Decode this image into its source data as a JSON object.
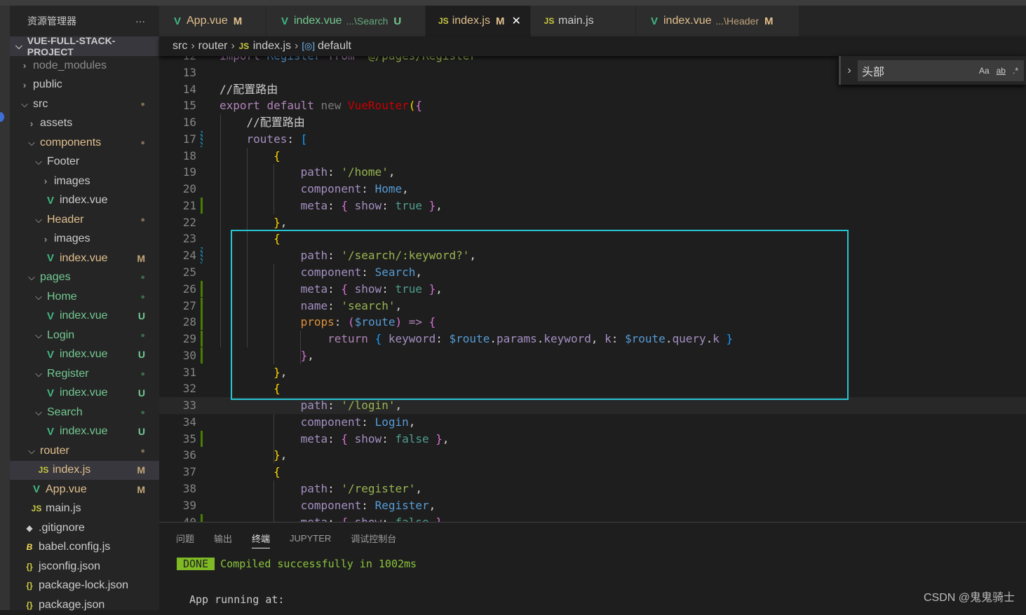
{
  "sidebar": {
    "title": "资源管理器",
    "more": "···",
    "project": "VUE-FULL-STACK-PROJECT",
    "items": [
      {
        "label": "node_modules",
        "level": 1,
        "icon": "chevron-right",
        "color": "#8c8c8c"
      },
      {
        "label": "public",
        "level": 1,
        "icon": "chevron-right",
        "color": "#cccccc"
      },
      {
        "label": "src",
        "level": 1,
        "icon": "chevron-down",
        "color": "#cccccc",
        "badge": "●",
        "badge_color": "#7d6e55"
      },
      {
        "label": "assets",
        "level": 2,
        "icon": "chevron-right",
        "color": "#cccccc"
      },
      {
        "label": "components",
        "level": 2,
        "icon": "chevron-down",
        "color": "#e2c08d",
        "badge": "●",
        "badge_color": "#7d6e55"
      },
      {
        "label": "Footer",
        "level": 3,
        "icon": "chevron-down",
        "color": "#cccccc"
      },
      {
        "label": "images",
        "level": 4,
        "icon": "chevron-right",
        "color": "#cccccc"
      },
      {
        "label": "index.vue",
        "level": 4,
        "icon": "vue",
        "color": "#cccccc"
      },
      {
        "label": "Header",
        "level": 3,
        "icon": "chevron-down",
        "color": "#e2c08d",
        "badge": "●",
        "badge_color": "#7d6e55"
      },
      {
        "label": "images",
        "level": 4,
        "icon": "chevron-right",
        "color": "#cccccc"
      },
      {
        "label": "index.vue",
        "level": 4,
        "icon": "vue",
        "color": "#e2c08d",
        "badge": "M",
        "badge_color": "#c2a679"
      },
      {
        "label": "pages",
        "level": 2,
        "icon": "chevron-down",
        "color": "#73c991",
        "badge": "●",
        "badge_color": "#3d6b4d"
      },
      {
        "label": "Home",
        "level": 3,
        "icon": "chevron-down",
        "color": "#73c991",
        "badge": "●",
        "badge_color": "#3d6b4d"
      },
      {
        "label": "index.vue",
        "level": 4,
        "icon": "vue",
        "color": "#73c991",
        "badge": "U",
        "badge_color": "#73c991"
      },
      {
        "label": "Login",
        "level": 3,
        "icon": "chevron-down",
        "color": "#73c991",
        "badge": "●",
        "badge_color": "#3d6b4d"
      },
      {
        "label": "index.vue",
        "level": 4,
        "icon": "vue",
        "color": "#73c991",
        "badge": "U",
        "badge_color": "#73c991"
      },
      {
        "label": "Register",
        "level": 3,
        "icon": "chevron-down",
        "color": "#73c991",
        "badge": "●",
        "badge_color": "#3d6b4d"
      },
      {
        "label": "index.vue",
        "level": 4,
        "icon": "vue",
        "color": "#73c991",
        "badge": "U",
        "badge_color": "#73c991"
      },
      {
        "label": "Search",
        "level": 3,
        "icon": "chevron-down",
        "color": "#73c991",
        "badge": "●",
        "badge_color": "#3d6b4d"
      },
      {
        "label": "index.vue",
        "level": 4,
        "icon": "vue",
        "color": "#73c991",
        "badge": "U",
        "badge_color": "#73c991"
      },
      {
        "label": "router",
        "level": 2,
        "icon": "chevron-down",
        "color": "#e2c08d",
        "badge": "●",
        "badge_color": "#7d6e55"
      },
      {
        "label": "index.js",
        "level": 3,
        "icon": "js",
        "color": "#e2c08d",
        "badge": "M",
        "badge_color": "#c2a679",
        "selected": true
      },
      {
        "label": "App.vue",
        "level": 2,
        "icon": "vue",
        "color": "#e2c08d",
        "badge": "M",
        "badge_color": "#c2a679"
      },
      {
        "label": "main.js",
        "level": 2,
        "icon": "js",
        "color": "#cccccc"
      },
      {
        "label": ".gitignore",
        "level": 1,
        "icon": "git",
        "color": "#cccccc"
      },
      {
        "label": "babel.config.js",
        "level": 1,
        "icon": "babel",
        "color": "#cccccc"
      },
      {
        "label": "jsconfig.json",
        "level": 1,
        "icon": "json",
        "color": "#cccccc"
      },
      {
        "label": "package-lock.json",
        "level": 1,
        "icon": "json",
        "color": "#cccccc"
      },
      {
        "label": "package.json",
        "level": 1,
        "icon": "json",
        "color": "#cccccc"
      }
    ]
  },
  "tabs": [
    {
      "label": "App.vue",
      "icon": "vue",
      "desc": "",
      "status": "M",
      "color": "#e2c08d"
    },
    {
      "label": "index.vue",
      "icon": "vue",
      "desc": "...\\Search",
      "status": "U",
      "color": "#73c991"
    },
    {
      "label": "index.js",
      "icon": "js",
      "desc": "",
      "status": "M",
      "color": "#e2c08d",
      "active": true,
      "close": "✕"
    },
    {
      "label": "main.js",
      "icon": "js",
      "desc": "",
      "status": "",
      "color": "#cccccc"
    },
    {
      "label": "index.vue",
      "icon": "vue",
      "desc": "...\\Header",
      "status": "M",
      "color": "#e2c08d"
    }
  ],
  "breadcrumb": [
    "src",
    "router",
    "index.js",
    "default"
  ],
  "find": {
    "value": "头部",
    "case": "Aa",
    "word": "ab",
    "regex": ".*"
  },
  "editor": {
    "first_line": 12,
    "current_line": 33,
    "lines": [
      [
        [
          "import ",
          "kw"
        ],
        [
          "Register ",
          "cls"
        ],
        [
          "from ",
          "kw"
        ],
        [
          "'@/pages/Register'",
          "str"
        ]
      ],
      [],
      [
        [
          "//配置路由",
          "cm"
        ]
      ],
      [
        [
          "export ",
          "kw"
        ],
        [
          "default ",
          "kw"
        ],
        [
          "new ",
          "new"
        ],
        [
          "VueRouter",
          "red"
        ],
        [
          "(",
          "b1"
        ],
        [
          "{",
          "b2"
        ]
      ],
      [
        [
          "    //配置路由",
          "cm"
        ]
      ],
      [
        [
          "    routes",
          "prop"
        ],
        [
          ": ",
          "p"
        ],
        [
          "[",
          "b3"
        ]
      ],
      [
        [
          "        {",
          "b1"
        ]
      ],
      [
        [
          "            path",
          "prop"
        ],
        [
          ": ",
          "p"
        ],
        [
          "'/home'",
          "str"
        ],
        [
          ",",
          "p"
        ]
      ],
      [
        [
          "            component",
          "prop"
        ],
        [
          ": ",
          "p"
        ],
        [
          "Home",
          "cls"
        ],
        [
          ",",
          "p"
        ]
      ],
      [
        [
          "            meta",
          "prop"
        ],
        [
          ": ",
          "p"
        ],
        [
          "{ ",
          "b2"
        ],
        [
          "show",
          "prop"
        ],
        [
          ": ",
          "p"
        ],
        [
          "true ",
          "bool"
        ],
        [
          "}",
          "b2"
        ],
        [
          ",",
          "p"
        ]
      ],
      [
        [
          "        }",
          "b1"
        ],
        [
          ",",
          "p"
        ]
      ],
      [
        [
          "        {",
          "b1"
        ]
      ],
      [
        [
          "            path",
          "prop"
        ],
        [
          ": ",
          "p"
        ],
        [
          "'/search/:keyword?'",
          "str"
        ],
        [
          ",",
          "p"
        ]
      ],
      [
        [
          "            component",
          "prop"
        ],
        [
          ": ",
          "p"
        ],
        [
          "Search",
          "cls"
        ],
        [
          ",",
          "p"
        ]
      ],
      [
        [
          "            meta",
          "prop"
        ],
        [
          ": ",
          "p"
        ],
        [
          "{ ",
          "b2"
        ],
        [
          "show",
          "prop"
        ],
        [
          ": ",
          "p"
        ],
        [
          "true ",
          "bool"
        ],
        [
          "}",
          "b2"
        ],
        [
          ",",
          "p"
        ]
      ],
      [
        [
          "            name",
          "prop"
        ],
        [
          ": ",
          "p"
        ],
        [
          "'search'",
          "str"
        ],
        [
          ",",
          "p"
        ]
      ],
      [
        [
          "            props",
          "fn"
        ],
        [
          ": ",
          "p"
        ],
        [
          "(",
          "b2"
        ],
        [
          "$route",
          "cls"
        ],
        [
          ") ",
          "b2"
        ],
        [
          "=> ",
          "kw"
        ],
        [
          "{",
          "b2"
        ]
      ],
      [
        [
          "                return ",
          "kw"
        ],
        [
          "{ ",
          "b3"
        ],
        [
          "keyword",
          "prop"
        ],
        [
          ": ",
          "p"
        ],
        [
          "$route",
          "cls"
        ],
        [
          ".",
          "p"
        ],
        [
          "params",
          "prop"
        ],
        [
          ".",
          "p"
        ],
        [
          "keyword",
          "prop"
        ],
        [
          ", ",
          "p"
        ],
        [
          "k",
          "prop"
        ],
        [
          ": ",
          "p"
        ],
        [
          "$route",
          "cls"
        ],
        [
          ".",
          "p"
        ],
        [
          "query",
          "prop"
        ],
        [
          ".",
          "p"
        ],
        [
          "k ",
          "prop"
        ],
        [
          "}",
          "b3"
        ]
      ],
      [
        [
          "            }",
          "b2"
        ],
        [
          ",",
          "p"
        ]
      ],
      [
        [
          "        }",
          "b1"
        ],
        [
          ",",
          "p"
        ]
      ],
      [
        [
          "        {",
          "b1"
        ]
      ],
      [
        [
          "            path",
          "prop"
        ],
        [
          ": ",
          "p"
        ],
        [
          "'/login'",
          "str"
        ],
        [
          ",",
          "p"
        ]
      ],
      [
        [
          "            component",
          "prop"
        ],
        [
          ": ",
          "p"
        ],
        [
          "Login",
          "cls"
        ],
        [
          ",",
          "p"
        ]
      ],
      [
        [
          "            meta",
          "prop"
        ],
        [
          ": ",
          "p"
        ],
        [
          "{ ",
          "b2"
        ],
        [
          "show",
          "prop"
        ],
        [
          ": ",
          "p"
        ],
        [
          "false ",
          "bool"
        ],
        [
          "}",
          "b2"
        ],
        [
          ",",
          "p"
        ]
      ],
      [
        [
          "        }",
          "b1"
        ],
        [
          ",",
          "p"
        ]
      ],
      [
        [
          "        {",
          "b1"
        ]
      ],
      [
        [
          "            path",
          "prop"
        ],
        [
          ": ",
          "p"
        ],
        [
          "'/register'",
          "str"
        ],
        [
          ",",
          "p"
        ]
      ],
      [
        [
          "            component",
          "prop"
        ],
        [
          ": ",
          "p"
        ],
        [
          "Register",
          "cls"
        ],
        [
          ",",
          "p"
        ]
      ],
      [
        [
          "            meta",
          "prop"
        ],
        [
          ": ",
          "p"
        ],
        [
          "{ ",
          "b2"
        ],
        [
          "show",
          "prop"
        ],
        [
          ": ",
          "p"
        ],
        [
          "false ",
          "bool"
        ],
        [
          "}",
          "b2"
        ]
      ]
    ],
    "git_markers": {
      "17": "mod",
      "21": "add",
      "24": "mod",
      "26": "add",
      "27": "add",
      "28": "add",
      "29": "add",
      "30": "add",
      "35": "add",
      "40": "add"
    }
  },
  "colors": {
    "kw": "#b084b8",
    "cls": "#569cd6",
    "str": "#98b450",
    "cm": "#cccccc",
    "new": "#7a7a7a",
    "red": "#c70000",
    "b1": "#ffd700",
    "b2": "#da70d6",
    "b3": "#179fff",
    "prop": "#a58fc2",
    "p": "#d4d4d4",
    "bool": "#4f9e8d",
    "fn": "#e0913a",
    "highlight_box": "#27c5d3"
  },
  "panel": {
    "tabs": [
      "问题",
      "输出",
      "终端",
      "JUPYTER",
      "调试控制台"
    ],
    "active_tab": "终端",
    "done": "DONE",
    "compiled": "Compiled successfully in 1002ms",
    "running": "App running at:"
  },
  "watermark": "CSDN @鬼鬼骑士"
}
